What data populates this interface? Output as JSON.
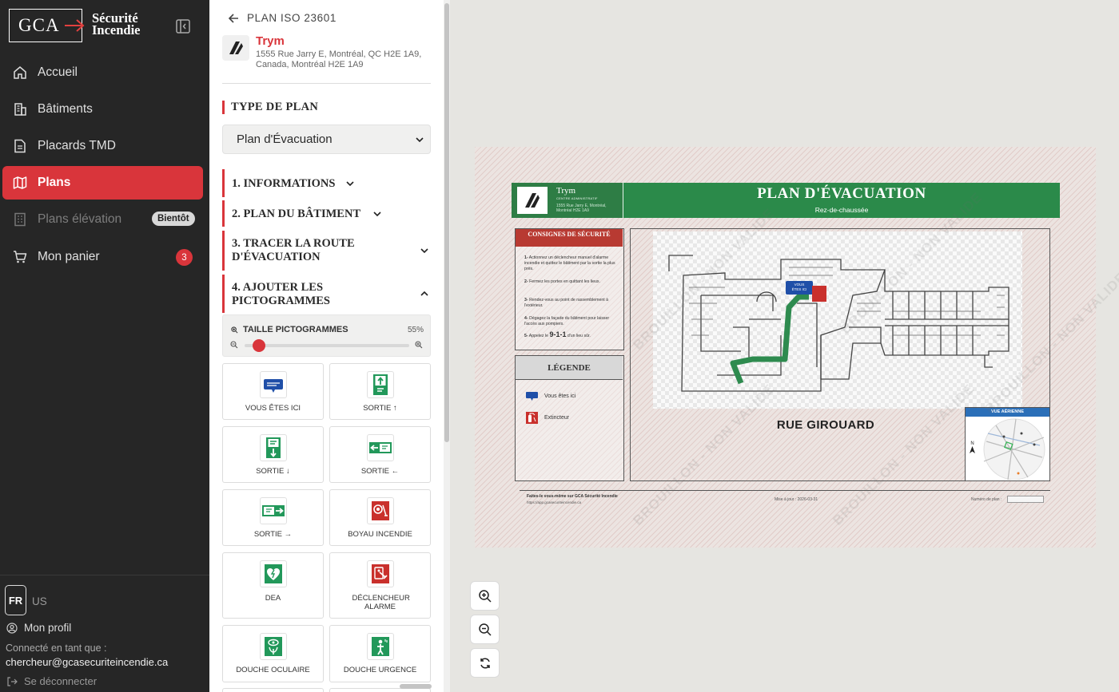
{
  "brand": {
    "logo_main": "GCA",
    "logo_line1": "Sécurité",
    "logo_line2": "Incendie"
  },
  "sidebar": {
    "items": [
      {
        "label": "Accueil",
        "icon": "home-icon"
      },
      {
        "label": "Bâtiments",
        "icon": "building-icon"
      },
      {
        "label": "Placards TMD",
        "icon": "document-icon"
      },
      {
        "label": "Plans",
        "icon": "map-icon",
        "active": true
      },
      {
        "label": "Plans élévation",
        "icon": "elevation-icon",
        "badge": "Bientôt",
        "disabled": true
      },
      {
        "label": "Mon panier",
        "icon": "cart-icon",
        "count": "3"
      }
    ],
    "lang_active": "FR",
    "lang_other": "US",
    "profile_label": "Mon profil",
    "connected_label": "Connecté en tant que :",
    "email": "chercheur@gcasecuriteincendie.ca",
    "logout_label": "Se déconnecter"
  },
  "panel": {
    "back_label": "PLAN ISO 23601",
    "building_name": "Trym",
    "building_address": "1555 Rue Jarry E, Montréal, QC H2E 1A9, Canada, Montréal H2E 1A9",
    "type_title": "TYPE DE PLAN",
    "type_value": "Plan d'Évacuation",
    "sections": [
      "1. INFORMATIONS",
      "2. PLAN DU BÂTIMENT",
      "3. TRACER LA ROUTE D'ÉVACUATION",
      "4. AJOUTER LES PICTOGRAMMES"
    ],
    "size_label": "TAILLE PICTOGRAMMES",
    "size_value": "55%",
    "size_fraction": 0.55,
    "pictograms": [
      {
        "label": "VOUS ÊTES ICI",
        "icon": "you-are-here-icon"
      },
      {
        "label": "SORTIE ↑",
        "icon": "exit-up-icon"
      },
      {
        "label": "SORTIE ↓",
        "icon": "exit-down-icon"
      },
      {
        "label": "SORTIE ←",
        "icon": "exit-left-icon"
      },
      {
        "label": "SORTIE →",
        "icon": "exit-right-icon"
      },
      {
        "label": "BOYAU INCENDIE",
        "icon": "fire-hose-icon"
      },
      {
        "label": "DEA",
        "icon": "defibrillator-icon"
      },
      {
        "label": "DÉCLENCHEUR ALARME",
        "icon": "fire-alarm-icon"
      },
      {
        "label": "DOUCHE OCULAIRE",
        "icon": "eye-wash-icon"
      },
      {
        "label": "DOUCHE URGENCE",
        "icon": "emergency-shower-icon"
      }
    ]
  },
  "plan": {
    "building_name": "Trym",
    "building_sub": "CENTRE ADMINISTRATIF",
    "building_address": "1555 Rue Jarry E, Montréal, Montréal H2E 1A9",
    "title": "PLAN D'ÉVACUATION",
    "subtitle": "Rez-de-chaussée",
    "consignes_title": "CONSIGNES DE SÉCURITÉ",
    "consignes": [
      {
        "n": "1-",
        "t": "Actionnez un déclencheur manuel d'alarme incendie et quittez le bâtiment par la sortie la plus près."
      },
      {
        "n": "2-",
        "t": "Fermez les portes en quittant les lieux."
      },
      {
        "n": "3-",
        "t": "Rendez-vous au point de rassemblement à l'extérieur."
      },
      {
        "n": "4-",
        "t": "Dégagez la façade du bâtiment pour laisser l'accès aux pompiers."
      },
      {
        "n": "5-",
        "t_before": "Appelez le ",
        "t_big": "9-1-1",
        "t_after": " d'un lieu sûr."
      }
    ],
    "legend_title": "LÉGENDE",
    "legend": [
      {
        "label": "Vous êtes ici",
        "icon": "you-are-here-icon"
      },
      {
        "label": "Extincteur",
        "icon": "extinguisher-icon"
      }
    ],
    "you_are_here_marker": "VOUS ÊTES ICI",
    "street": "RUE GIROUARD",
    "aerial_title": "VUE AÉRIENNE",
    "north": "N",
    "footer_brand": "Faites-le vous-même sur GCA Sécurité Incendie",
    "footer_url": "https://app.gcasecuriteincendie.ca",
    "footer_date": "Mise à jour : 2026-03-31",
    "footer_plan_no": "Numéro de plan :",
    "watermark": "BROUILLON - NON VALIDE"
  },
  "colors": {
    "accent": "#d9353b",
    "green": "#2b8a4a",
    "sidebar": "#262626",
    "consignes_red": "#b83a32"
  }
}
